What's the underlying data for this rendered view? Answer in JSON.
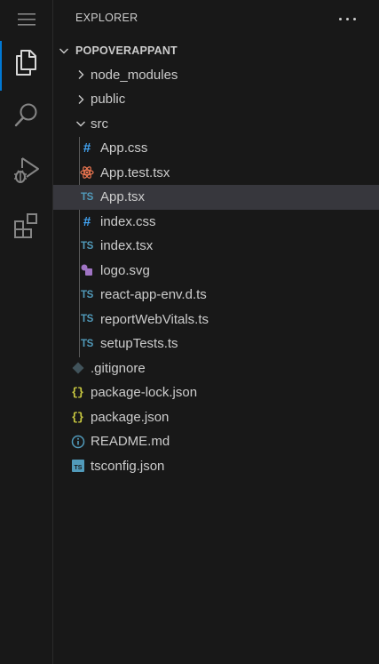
{
  "activity_bar": {
    "items": [
      {
        "name": "menu",
        "icon": "hamburger-menu-icon"
      },
      {
        "name": "explorer",
        "icon": "files-icon",
        "active": true
      },
      {
        "name": "search",
        "icon": "search-icon"
      },
      {
        "name": "run-debug",
        "icon": "run-debug-icon"
      },
      {
        "name": "extensions",
        "icon": "extensions-icon"
      }
    ]
  },
  "explorer": {
    "title": "EXPLORER",
    "more_actions_icon": "ellipsis-icon",
    "root": "POPOVERAPPANT",
    "folders": {
      "node_modules": "node_modules",
      "public": "public",
      "src": "src"
    },
    "src_files": {
      "app_css": "App.css",
      "app_test": "App.test.tsx",
      "app_tsx": "App.tsx",
      "index_css": "index.css",
      "index_tsx": "index.tsx",
      "logo_svg": "logo.svg",
      "react_app_env": "react-app-env.d.ts",
      "report_web_vitals": "reportWebVitals.ts",
      "setup_tests": "setupTests.ts"
    },
    "root_files": {
      "gitignore": ".gitignore",
      "package_lock": "package-lock.json",
      "package_json": "package.json",
      "readme": "README.md",
      "tsconfig": "tsconfig.json"
    },
    "icon_glyphs": {
      "css": "#",
      "ts": "TS",
      "json": "{}"
    },
    "selected": "App.tsx"
  },
  "colors": {
    "background": "#181818",
    "selection": "#37373d",
    "accent": "#0078d4",
    "css_icon": "#42a5f5",
    "ts_icon": "#519aba",
    "json_icon": "#cbcb41",
    "react_icon": "#e8744f",
    "svg_icon": "#a074c4"
  }
}
